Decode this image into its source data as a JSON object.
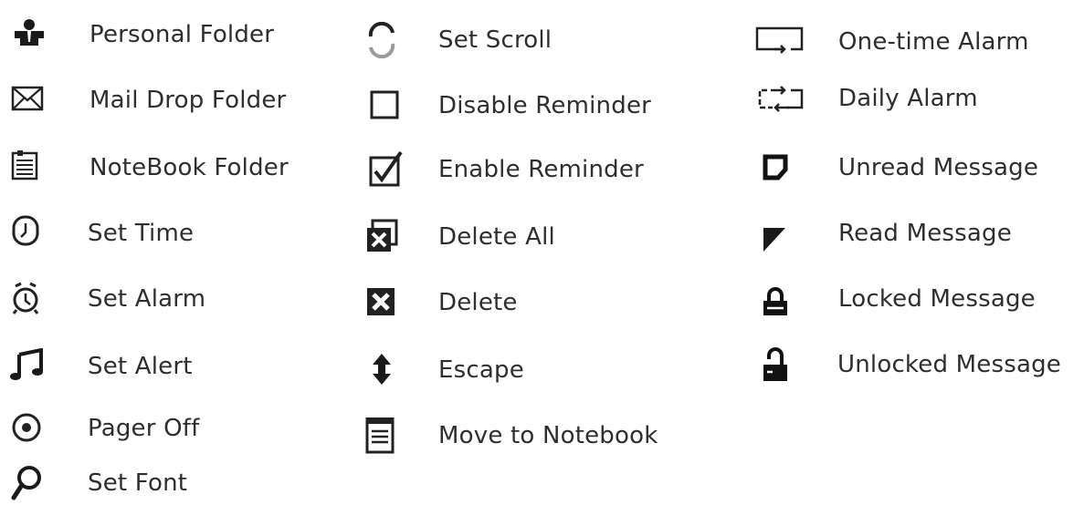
{
  "legend": {
    "columns": [
      {
        "items": [
          {
            "label": "Personal Folder",
            "icon": "personal-folder-icon"
          },
          {
            "label": "Mail Drop Folder",
            "icon": "envelope-icon"
          },
          {
            "label": "NoteBook Folder",
            "icon": "notebook-folder-icon"
          },
          {
            "label": "Set Time",
            "icon": "clock-icon"
          },
          {
            "label": "Set Alarm",
            "icon": "alarm-clock-icon"
          },
          {
            "label": "Set Alert",
            "icon": "music-note-icon"
          },
          {
            "label": "Pager Off",
            "icon": "target-circle-icon"
          },
          {
            "label": "Set Font",
            "icon": "magnifier-icon"
          }
        ]
      },
      {
        "items": [
          {
            "label": "Set Scroll",
            "icon": "scroll-arrows-icon"
          },
          {
            "label": "Disable Reminder",
            "icon": "empty-checkbox-icon"
          },
          {
            "label": "Enable Reminder",
            "icon": "checked-checkbox-icon"
          },
          {
            "label": "Delete All",
            "icon": "delete-all-icon"
          },
          {
            "label": "Delete",
            "icon": "delete-icon"
          },
          {
            "label": "Escape",
            "icon": "up-down-arrow-icon"
          },
          {
            "label": "Move to Notebook",
            "icon": "notebook-icon"
          }
        ]
      },
      {
        "items": [
          {
            "label": "One-time Alarm",
            "icon": "one-time-alarm-icon"
          },
          {
            "label": "Daily Alarm",
            "icon": "daily-alarm-icon"
          },
          {
            "label": "Unread Message",
            "icon": "unread-message-icon"
          },
          {
            "label": "Read Message",
            "icon": "read-message-icon"
          },
          {
            "label": "Locked Message",
            "icon": "lock-closed-icon"
          },
          {
            "label": "Unlocked Message",
            "icon": "lock-open-icon"
          }
        ]
      }
    ]
  }
}
